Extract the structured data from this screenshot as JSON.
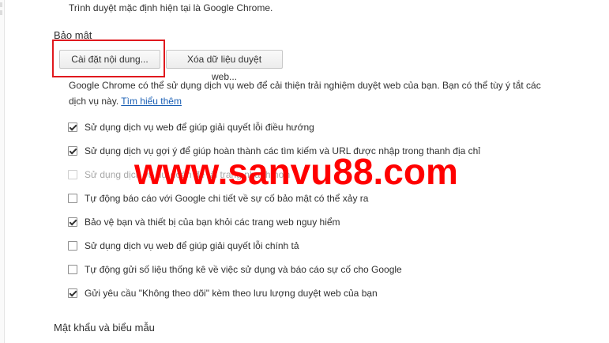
{
  "default_browser_text": "Trình duyệt mặc định hiện tại là Google Chrome.",
  "privacy": {
    "title": "Bảo mật",
    "content_settings_button": "Cài đặt nội dung...",
    "clear_data_button": "Xóa dữ liệu duyệt web...",
    "description_line1": "Google Chrome có thể sử dụng dịch vụ web để cải thiện trải nghiệm duyệt web của bạn. Bạn có thể tùy ý tắt các",
    "description_line2": "dịch vụ này.",
    "learn_more": "Tìm hiểu thêm",
    "options": [
      {
        "label": "Sử dụng dịch vụ web để giúp giải quyết lỗi điều hướng",
        "checked": true,
        "enabled": true
      },
      {
        "label": "Sử dụng dịch vụ gợi ý để giúp hoàn thành các tìm kiếm và URL được nhập trong thanh địa chỉ",
        "checked": true,
        "enabled": true
      },
      {
        "label": "Sử dụng dịch vụ dự đoán để tải trang nhanh hơn",
        "checked": false,
        "enabled": false
      },
      {
        "label": "Tự động báo cáo với Google chi tiết về sự cố bảo mật có thể xảy ra",
        "checked": false,
        "enabled": true
      },
      {
        "label": "Bảo vệ bạn và thiết bị của bạn khỏi các trang web nguy hiểm",
        "checked": true,
        "enabled": true
      },
      {
        "label": "Sử dụng dịch vụ web để giúp giải quyết lỗi chính tả",
        "checked": false,
        "enabled": true
      },
      {
        "label": "Tự động gửi số liệu thống kê về việc sử dụng và báo cáo sự cố cho Google",
        "checked": false,
        "enabled": true
      },
      {
        "label": "Gửi yêu cầu \"Không theo dõi\" kèm theo lưu lượng duyệt web của bạn",
        "checked": true,
        "enabled": true
      }
    ]
  },
  "passwords": {
    "title": "Mật khẩu và biểu mẫu"
  },
  "watermark_text": "www.sanvu88.com",
  "colors": {
    "highlight": "#e0191e",
    "watermark": "#ff0000",
    "link": "#1a5fb4"
  }
}
